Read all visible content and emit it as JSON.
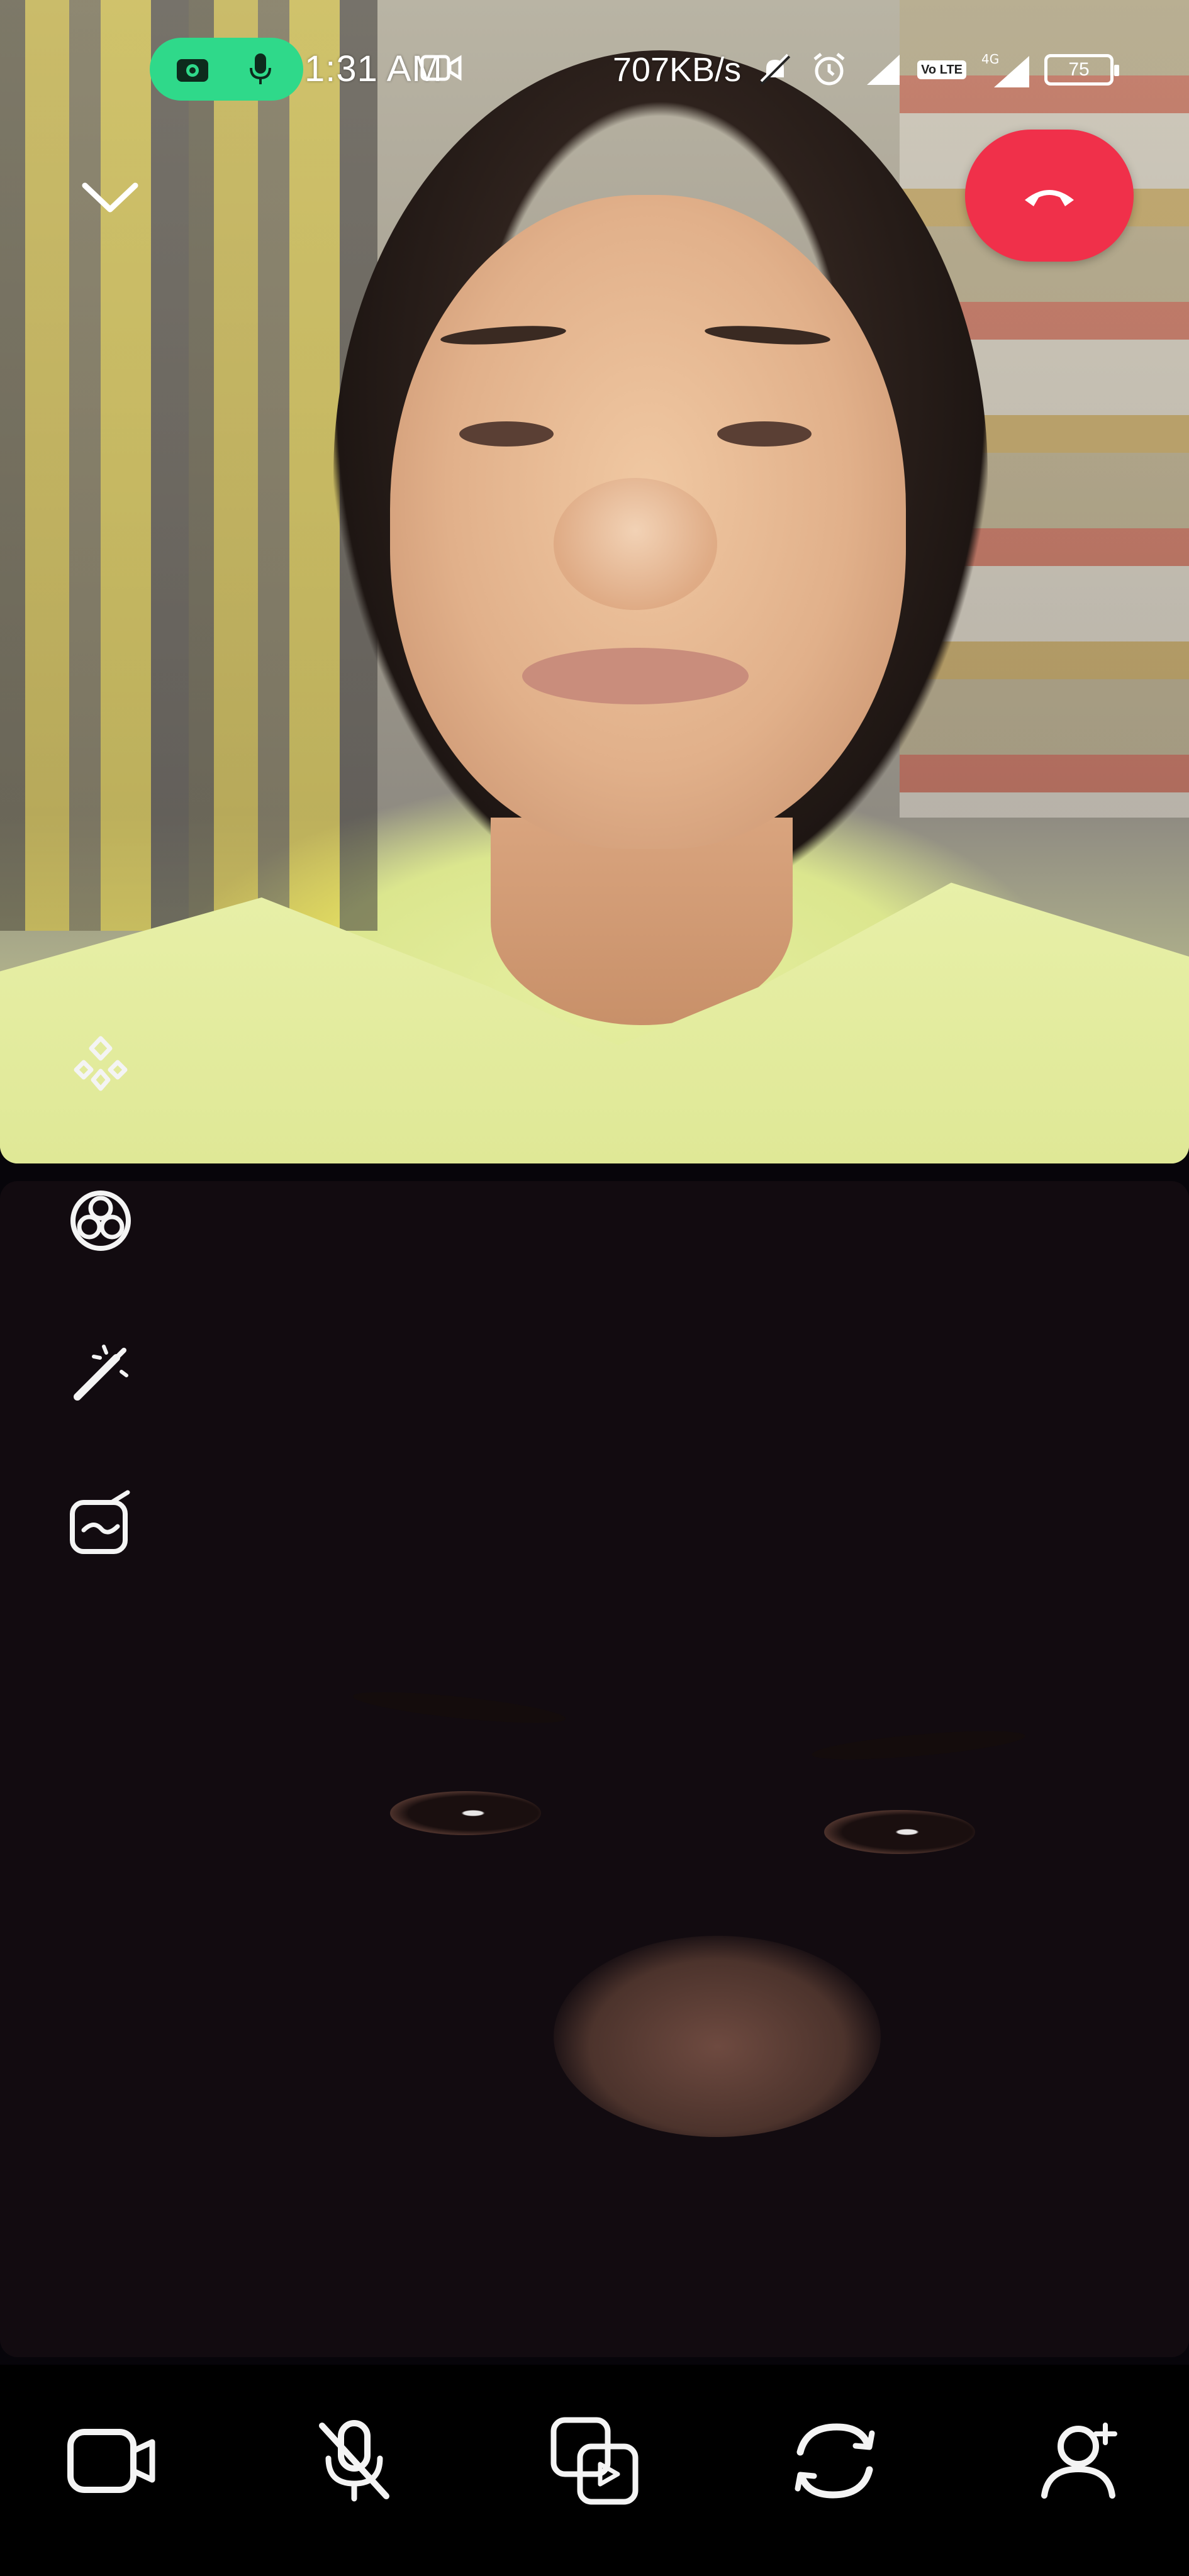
{
  "status_bar": {
    "time": "1:31 AM",
    "net_speed": "707KB/s",
    "volte_label": "Vo LTE",
    "network_type": "4G",
    "battery_level": "75",
    "active_call_indicators": [
      "camera-icon",
      "microphone-icon"
    ],
    "icons": [
      "video-recording-icon",
      "mute-notifications-icon",
      "alarm-icon",
      "signal-icon",
      "volte-icon",
      "signal-4g-icon",
      "battery-icon"
    ]
  },
  "call": {
    "controls_top": [
      "collapse-chevron-icon",
      "end-call-icon"
    ],
    "side_tools": [
      "filter-icon",
      "magic-wand-icon",
      "background-edit-icon",
      "effects-icon"
    ],
    "bottom_tools": [
      "camera-off-icon",
      "mic-off-icon",
      "screen-share-icon",
      "switch-camera-icon",
      "add-participant-icon"
    ]
  },
  "colors": {
    "call_pill": "#2fd98a",
    "end_call": "#f0304a",
    "bottom_bar": "#000000",
    "icon_white": "#f4f4f4"
  }
}
